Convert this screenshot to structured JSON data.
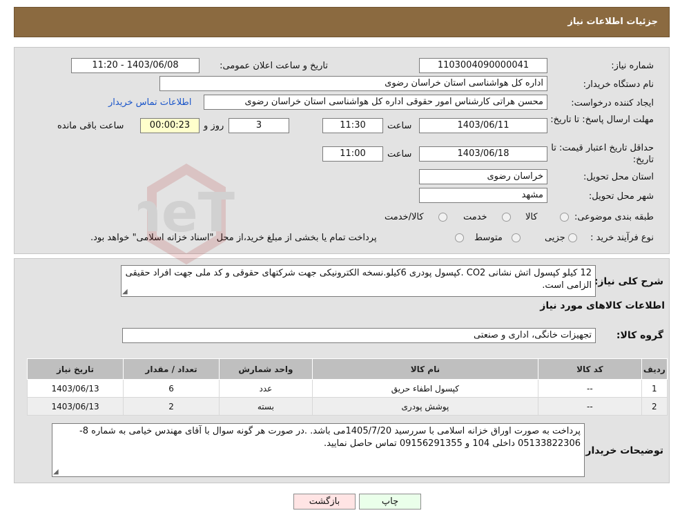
{
  "header": {
    "title": "جزئیات اطلاعات نیاز"
  },
  "form": {
    "need_number": {
      "label": "شماره نیاز:",
      "value": "1103004090000041"
    },
    "announce": {
      "label": "تاریخ و ساعت اعلان عمومی:",
      "value": "1403/06/08 - 11:20"
    },
    "buyer": {
      "label": "نام دستگاه خریدار:",
      "value": "اداره کل هواشناسی استان خراسان رضوی"
    },
    "requester": {
      "label": "ایجاد کننده درخواست:",
      "value": "محسن هراتی کارشناس امور حقوقی اداره کل هواشناسی استان خراسان رضوی",
      "contact_link": "اطلاعات تماس خریدار"
    },
    "deadline": {
      "label": "مهلت ارسال پاسخ: تا تاریخ:",
      "date": "1403/06/11",
      "time_label": "ساعت",
      "time": "11:30",
      "days": "3",
      "days_label": "روز و",
      "remaining": "00:00:23",
      "remaining_label": "ساعت باقی مانده"
    },
    "validity": {
      "label": "حداقل تاریخ اعتبار قیمت: تا تاریخ:",
      "date": "1403/06/18",
      "time_label": "ساعت",
      "time": "11:00"
    },
    "province": {
      "label": "استان محل تحویل:",
      "value": "خراسان رضوی"
    },
    "city": {
      "label": "شهر محل تحویل:",
      "value": "مشهد"
    },
    "category": {
      "label": "طبقه بندی موضوعی:",
      "options": [
        "کالا",
        "خدمت",
        "کالا/خدمت"
      ]
    },
    "process": {
      "label": "نوع فرآیند خرید :",
      "options": [
        "جزیی",
        "متوسط"
      ],
      "note": "پرداخت تمام یا بخشی از مبلغ خرید،از محل \"اسناد خزانه اسلامی\" خواهد بود."
    }
  },
  "details": {
    "desc_label": "شرح کلی نیاز:",
    "desc": "12 کیلو کپسول اتش نشانی CO2 .کپسول پودری 6کیلو.نسخه الکترونیکی جهت شرکتهای حقوقی و کد ملی جهت افراد حقیقی الزامی است.",
    "goods_title": "اطلاعات کالاهای مورد نیاز",
    "group_label": "گروه کالا:",
    "group_value": "تجهیزات خانگی، اداری و صنعتی",
    "table": {
      "headers": [
        "ردیف",
        "کد کالا",
        "نام کالا",
        "واحد شمارش",
        "تعداد / مقدار",
        "تاریخ نیاز"
      ],
      "rows": [
        [
          "1",
          "--",
          "کپسول اطفاء حریق",
          "عدد",
          "6",
          "1403/06/13"
        ],
        [
          "2",
          "--",
          "پوشش پودری",
          "بسته",
          "2",
          "1403/06/13"
        ]
      ]
    },
    "buyer_notes_label": "توضیحات خریدار:",
    "buyer_notes": "پرداخت به صورت اوراق خزانه اسلامی با سررسید 1405/7/20می باشد. .در صورت هر گونه سوال با آقای مهندس خیامی به شماره 8-05133822306 داخلی 104 و 09156291355 تماس حاصل نمایید."
  },
  "buttons": {
    "print": "چاپ",
    "back": "بازگشت"
  },
  "colors": {
    "header_bg": "#8b6a40",
    "panel_bg": "#e3e3e3",
    "print_btn": "#eaffea",
    "back_btn": "#ffe4e4",
    "link": "#1a55c9"
  },
  "watermark": {
    "text": "AriaTender.neT"
  }
}
